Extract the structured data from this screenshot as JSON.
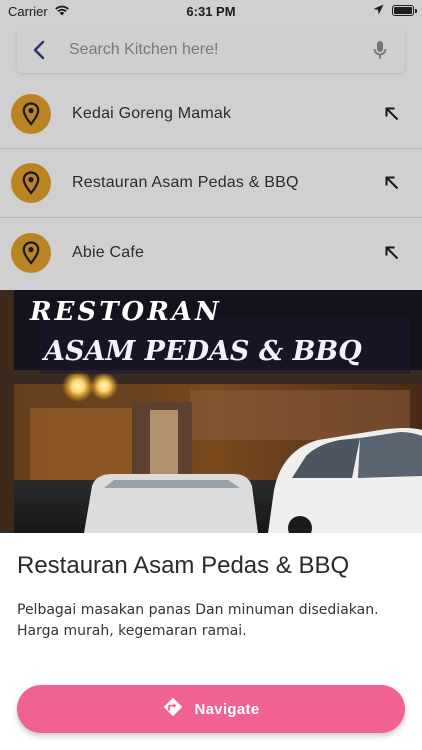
{
  "status_bar": {
    "carrier": "Carrier",
    "time": "6:31 PM",
    "icons": [
      "wifi-icon",
      "location-arrow-icon",
      "battery-icon"
    ]
  },
  "search": {
    "placeholder": "Search Kitchen here!",
    "value": "",
    "back_icon": "chevron-left-icon",
    "mic_icon": "microphone-icon"
  },
  "results": [
    {
      "name": "Kedai Goreng Mamak",
      "icon": "location-pin-icon",
      "action_icon": "arrow-up-left-icon"
    },
    {
      "name": "Restauran Asam Pedas & BBQ",
      "icon": "location-pin-icon",
      "action_icon": "arrow-up-left-icon"
    },
    {
      "name": "Abie Cafe",
      "icon": "location-pin-icon",
      "action_icon": "arrow-up-left-icon"
    }
  ],
  "detail": {
    "photo_sign_line1": "RESTORAN",
    "photo_sign_line2": "ASAM PEDAS & BBQ",
    "title": "Restauran Asam Pedas & BBQ",
    "description": "Pelbagai masakan panas Dan minuman disediakan. Harga murah, kegemaran ramai.",
    "navigate_label": "Navigate",
    "navigate_icon": "directions-icon"
  },
  "colors": {
    "accent": "#ef6291",
    "pin": "#d99a2b",
    "back_chevron": "#2f3c8f"
  }
}
